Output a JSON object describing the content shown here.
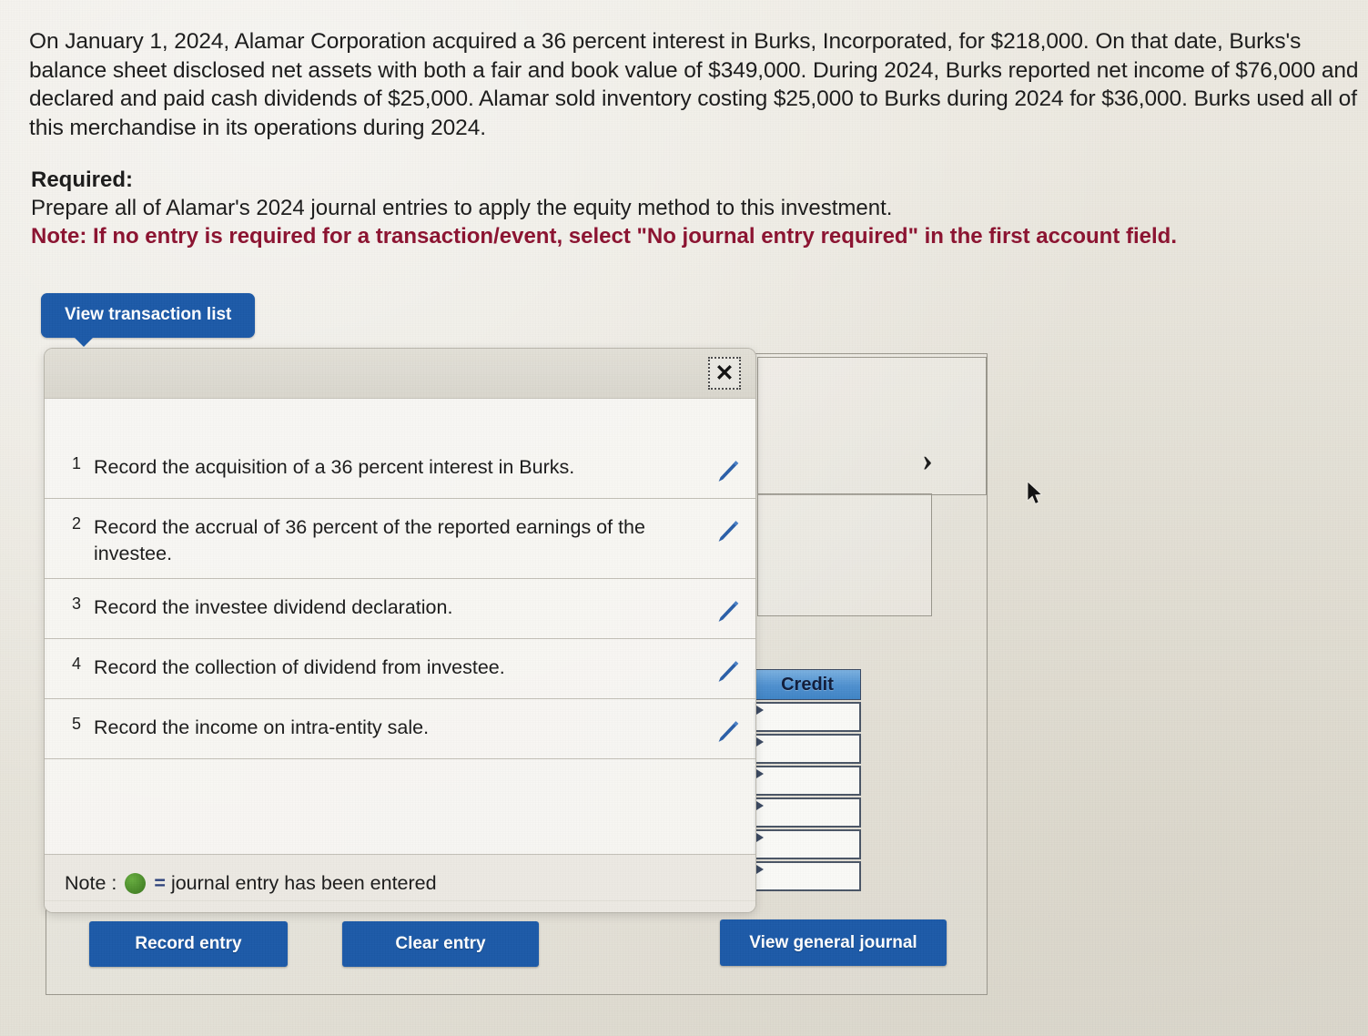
{
  "problem": {
    "paragraph": "On January 1, 2024, Alamar Corporation acquired a 36 percent interest in Burks, Incorporated, for $218,000. On that date, Burks's balance sheet disclosed net assets with both a fair and book value of $349,000. During 2024, Burks reported net income of $76,000 and declared and paid cash dividends of $25,000. Alamar sold inventory costing $25,000 to Burks during 2024 for $36,000. Burks used all of this merchandise in its operations during 2024.",
    "required_label": "Required:",
    "required_text": "Prepare all of Alamar's 2024 journal entries to apply the equity method to this investment.",
    "note_text": "Note: If no entry is required for a transaction/event, select \"No journal entry required\" in the first account field."
  },
  "tabs": {
    "view_transaction_list": "View transaction list"
  },
  "modal": {
    "close_icon": "close-icon",
    "close_glyph": "✕",
    "transactions": [
      {
        "num": "1",
        "desc": "Record the acquisition of a 36 percent interest in Burks.",
        "edit_icon": "pencil-icon"
      },
      {
        "num": "2",
        "desc": "Record the accrual of 36 percent of the reported earnings of the investee.",
        "edit_icon": "pencil-icon"
      },
      {
        "num": "3",
        "desc": "Record the investee dividend declaration.",
        "edit_icon": "pencil-icon"
      },
      {
        "num": "4",
        "desc": "Record the collection of dividend from investee.",
        "edit_icon": "pencil-icon"
      },
      {
        "num": "5",
        "desc": "Record the income on intra-entity sale.",
        "edit_icon": "pencil-icon"
      }
    ],
    "note_prefix": "Note :",
    "note_equals": "=",
    "note_suffix": "journal entry has been entered",
    "note_dot_color": "#4f8f2c"
  },
  "journal": {
    "credit_header": "Credit",
    "credit_rows": [
      "",
      "",
      "",
      "",
      "",
      ""
    ],
    "chevron_glyph": "›"
  },
  "buttons": {
    "record_entry": "Record entry",
    "clear_entry": "Clear entry",
    "view_general_journal": "View general journal"
  },
  "colors": {
    "accent_blue": "#1c5aa8",
    "header_blue": "#4e90cf",
    "note_red": "#8c1230",
    "green": "#4f8f2c"
  }
}
